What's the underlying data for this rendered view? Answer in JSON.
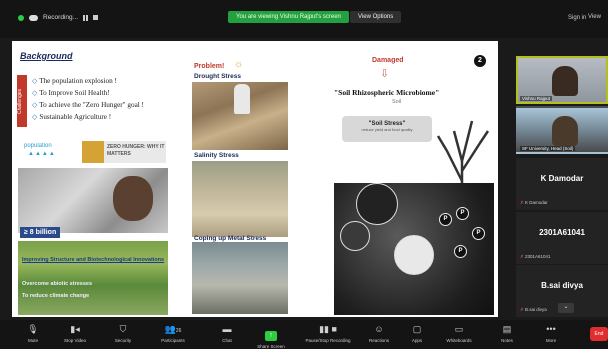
{
  "topbar": {
    "recording_label": "Recording...",
    "share_banner": "You are viewing Vishnu Rajput's screen",
    "view_options": "View Options",
    "sign_in": "Sign in",
    "view": "View"
  },
  "slide": {
    "background_title": "Background",
    "challenges_label": "Challenges",
    "bullets": [
      "The population explosion !",
      "To Improve Soil Health!",
      "To achieve the \"Zero Hunger\" goal !",
      "Sustainable Agriculture !"
    ],
    "population_label": "population",
    "zero_hunger": "ZERO HUNGER: WHY IT MATTERS",
    "billion_label": "≥ 8 billion",
    "farm_text_1": "Improving Structure and Biotechnological Innovations",
    "farm_text_2": "Overcome abiotic stresses",
    "farm_text_3": "To reduce climate change",
    "problem_label": "Problem!",
    "drought_label": "Drought Stress",
    "salinity_label": "Salinity Stress",
    "metal_label": "Coping up Metal Stress",
    "damaged_label": "Damaged",
    "slide_number": "2",
    "rhizo_title": "\"Soil Rhizospheric Microbiome\"",
    "soil_label": "Soil",
    "soil_stress_title": "\"Soil Stress\"",
    "soil_stress_sub": "reduce yield and food quality"
  },
  "participants": [
    {
      "type": "video",
      "name": "Vishnu Rajput"
    },
    {
      "type": "video",
      "name": "SF University, Head (Soil)"
    },
    {
      "type": "tile",
      "name": "K Damodar",
      "sub": "K Damodar"
    },
    {
      "type": "tile",
      "name": "2301A61041",
      "sub": "2301A61041"
    },
    {
      "type": "tile",
      "name": "B.sai divya",
      "sub": "B.sai divya"
    }
  ],
  "toolbar": {
    "items": [
      {
        "icon": "mic-icon",
        "label": "Mute"
      },
      {
        "icon": "camera-icon",
        "label": "Stop Video"
      },
      {
        "icon": "shield-icon",
        "label": "Security"
      },
      {
        "icon": "participants-icon",
        "label": "Participants"
      },
      {
        "icon": "chat-icon",
        "label": "Chat"
      },
      {
        "icon": "share-screen-icon",
        "label": "Share Screen"
      },
      {
        "icon": "record-icon",
        "label": "Pause/Stop Recording"
      },
      {
        "icon": "reactions-icon",
        "label": "Reactions"
      },
      {
        "icon": "apps-icon",
        "label": "Apps"
      },
      {
        "icon": "whiteboard-icon",
        "label": "Whiteboards"
      },
      {
        "icon": "notes-icon",
        "label": "Notes"
      },
      {
        "icon": "more-icon",
        "label": "More"
      }
    ],
    "participant_count": "26",
    "end_label": "End"
  },
  "colors": {
    "accent_green": "#2ecc40",
    "end_red": "#e02e2e",
    "active_speaker_border": "#b2c11e"
  }
}
